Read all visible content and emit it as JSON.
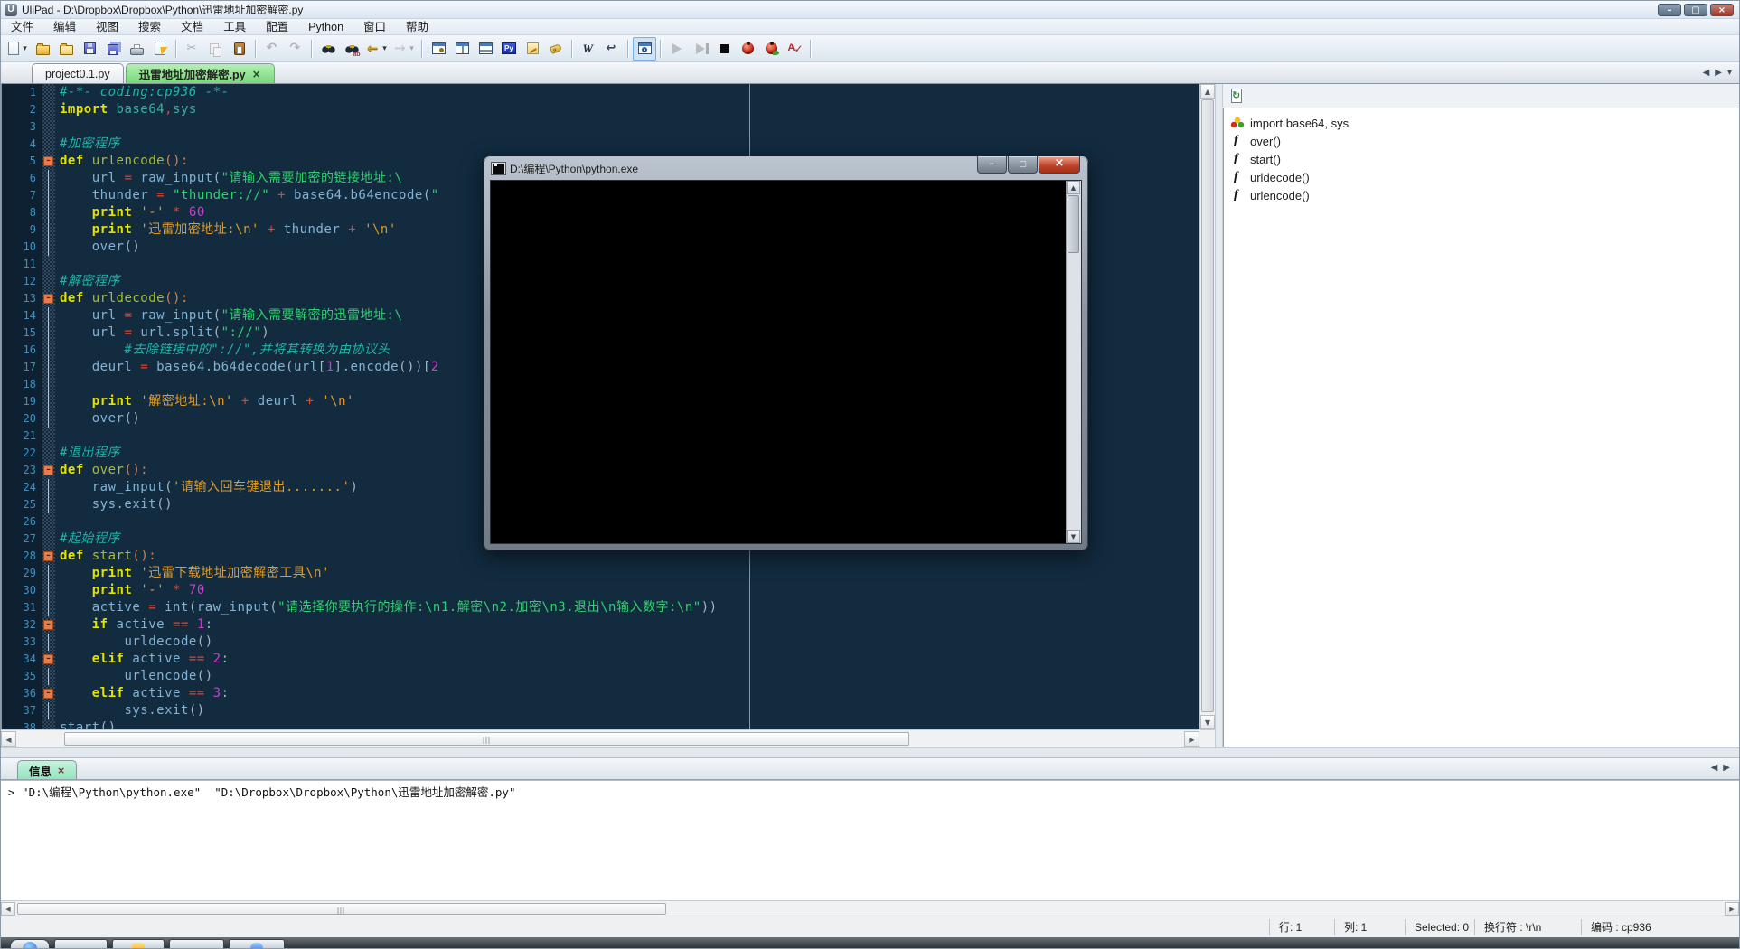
{
  "window": {
    "title": "UliPad - D:\\Dropbox\\Dropbox\\Python\\迅雷地址加密解密.py"
  },
  "menu": {
    "items": [
      {
        "id": "file",
        "label": "文件"
      },
      {
        "id": "edit",
        "label": "编辑"
      },
      {
        "id": "view",
        "label": "视图"
      },
      {
        "id": "search",
        "label": "搜索"
      },
      {
        "id": "document",
        "label": "文档"
      },
      {
        "id": "tools",
        "label": "工具"
      },
      {
        "id": "config",
        "label": "配置"
      },
      {
        "id": "python",
        "label": "Python"
      },
      {
        "id": "window",
        "label": "窗口"
      },
      {
        "id": "help",
        "label": "帮助"
      }
    ]
  },
  "toolbar": {
    "items": [
      {
        "id": "new-file",
        "icon": "page",
        "dd": true
      },
      {
        "id": "open-file",
        "icon": "folder-open"
      },
      {
        "id": "open-session",
        "icon": "folder"
      },
      {
        "id": "save",
        "icon": "floppy"
      },
      {
        "id": "save-all",
        "icon": "floppy-multi"
      },
      {
        "id": "print",
        "icon": "printer"
      },
      {
        "id": "shell-command",
        "icon": "page-flash"
      },
      {
        "sep": true
      },
      {
        "id": "cut",
        "icon": "cut",
        "disabled": true
      },
      {
        "id": "copy",
        "icon": "copy",
        "disabled": true
      },
      {
        "id": "paste",
        "icon": "paste"
      },
      {
        "sep": true
      },
      {
        "id": "undo",
        "icon": "undo",
        "disabled": true
      },
      {
        "id": "redo",
        "icon": "redo",
        "disabled": true
      },
      {
        "sep": true
      },
      {
        "id": "find",
        "icon": "find"
      },
      {
        "id": "replace",
        "icon": "replace"
      },
      {
        "id": "nav-back",
        "icon": "back",
        "dd": true
      },
      {
        "id": "nav-forward",
        "icon": "forward",
        "dd": true,
        "disabled": true
      },
      {
        "sep": true
      },
      {
        "id": "document-properties",
        "icon": "win-gear"
      },
      {
        "id": "split-vertically",
        "icon": "win-vsplit"
      },
      {
        "id": "split-horizontally",
        "icon": "win-hsplit"
      },
      {
        "id": "python-doc",
        "icon": "pyp"
      },
      {
        "id": "snippets",
        "icon": "note"
      },
      {
        "id": "bookmarks",
        "icon": "tag"
      },
      {
        "sep": true
      },
      {
        "id": "word-wrap",
        "icon": "wc"
      },
      {
        "id": "auto-indent",
        "icon": "indent"
      },
      {
        "sep": true
      },
      {
        "id": "messages-window",
        "icon": "preview",
        "pressed": true
      },
      {
        "sep": true
      },
      {
        "id": "run",
        "icon": "play",
        "disabled": true
      },
      {
        "id": "run-step",
        "icon": "play-step",
        "disabled": true
      },
      {
        "id": "stop",
        "icon": "stop"
      },
      {
        "id": "debug",
        "icon": "bug"
      },
      {
        "id": "debug-run",
        "icon": "bug-green"
      },
      {
        "id": "spell-check",
        "icon": "abc"
      },
      {
        "sep": true
      }
    ]
  },
  "tabs": [
    {
      "id": "project01",
      "label": "project0.1.py",
      "active": false
    },
    {
      "id": "thunder-codec",
      "label": "迅雷地址加密解密.py",
      "active": true,
      "close": "×"
    }
  ],
  "editor": {
    "lines": [
      {
        "n": 1,
        "f": "",
        "s": [
          [
            "#-*- coding:cp936 -*-",
            "cm"
          ]
        ]
      },
      {
        "n": 2,
        "f": "",
        "s": [
          [
            "import",
            "kw"
          ],
          [
            " ",
            ""
          ],
          [
            "base64",
            "md"
          ],
          [
            ",",
            "op"
          ],
          [
            "sys",
            "md"
          ]
        ]
      },
      {
        "n": 3,
        "f": "",
        "s": []
      },
      {
        "n": 4,
        "f": "",
        "s": [
          [
            "#加密程序",
            "cm"
          ]
        ]
      },
      {
        "n": 5,
        "f": "m",
        "s": [
          [
            "def",
            "kw"
          ],
          [
            " ",
            ""
          ],
          [
            "urlencode",
            "fn"
          ],
          [
            "():",
            "pd"
          ]
        ]
      },
      {
        "n": 6,
        "f": "l",
        "s": [
          [
            "    ",
            ""
          ],
          [
            "url",
            "id"
          ],
          [
            " = ",
            "op"
          ],
          [
            "raw_input",
            "id"
          ],
          [
            "(",
            "pn"
          ],
          [
            "\"请输入需要加密的链接地址:\\",
            "s2"
          ]
        ]
      },
      {
        "n": 7,
        "f": "l",
        "s": [
          [
            "    ",
            ""
          ],
          [
            "thunder",
            "id"
          ],
          [
            " = ",
            "op"
          ],
          [
            "\"thunder://\"",
            "s2"
          ],
          [
            " + ",
            "op"
          ],
          [
            "base64.b64encode",
            "id"
          ],
          [
            "(",
            "pn"
          ],
          [
            "\"",
            "s2"
          ]
        ]
      },
      {
        "n": 8,
        "f": "l",
        "s": [
          [
            "    ",
            ""
          ],
          [
            "print",
            "kw"
          ],
          [
            " ",
            ""
          ],
          [
            "'-'",
            "s1"
          ],
          [
            " ",
            ""
          ],
          [
            "*",
            "op"
          ],
          [
            " ",
            ""
          ],
          [
            "60",
            "nm"
          ]
        ]
      },
      {
        "n": 9,
        "f": "l",
        "s": [
          [
            "    ",
            ""
          ],
          [
            "print",
            "kw"
          ],
          [
            " ",
            ""
          ],
          [
            "'迅雷加密地址:\\n'",
            "s1"
          ],
          [
            " + ",
            "op"
          ],
          [
            "thunder",
            "id"
          ],
          [
            " + ",
            "op"
          ],
          [
            "'\\n'",
            "s1"
          ]
        ]
      },
      {
        "n": 10,
        "f": "l",
        "s": [
          [
            "    ",
            ""
          ],
          [
            "over",
            "id"
          ],
          [
            "()",
            "pn"
          ]
        ]
      },
      {
        "n": 11,
        "f": "",
        "s": []
      },
      {
        "n": 12,
        "f": "",
        "s": [
          [
            "#解密程序",
            "cm"
          ]
        ]
      },
      {
        "n": 13,
        "f": "m",
        "s": [
          [
            "def",
            "kw"
          ],
          [
            " ",
            ""
          ],
          [
            "urldecode",
            "fn"
          ],
          [
            "():",
            "pd"
          ]
        ]
      },
      {
        "n": 14,
        "f": "l",
        "s": [
          [
            "    ",
            ""
          ],
          [
            "url",
            "id"
          ],
          [
            " = ",
            "op"
          ],
          [
            "raw_input",
            "id"
          ],
          [
            "(",
            "pn"
          ],
          [
            "\"请输入需要解密的迅雷地址:\\",
            "s2"
          ]
        ]
      },
      {
        "n": 15,
        "f": "l",
        "s": [
          [
            "    ",
            ""
          ],
          [
            "url",
            "id"
          ],
          [
            " = ",
            "op"
          ],
          [
            "url.split",
            "id"
          ],
          [
            "(",
            "pn"
          ],
          [
            "\"://\"",
            "s2"
          ],
          [
            ")",
            "pn"
          ]
        ]
      },
      {
        "n": 16,
        "f": "l",
        "s": [
          [
            "        #去除链接中的\"://\",并将其转换为由协议头",
            "cm"
          ]
        ]
      },
      {
        "n": 17,
        "f": "l",
        "s": [
          [
            "    ",
            ""
          ],
          [
            "deurl",
            "id"
          ],
          [
            " = ",
            "op"
          ],
          [
            "base64.b64decode",
            "id"
          ],
          [
            "(",
            "pn"
          ],
          [
            "url",
            "id"
          ],
          [
            "[",
            "pn"
          ],
          [
            "1",
            "nm"
          ],
          [
            "]",
            "pn"
          ],
          [
            ".encode",
            "id"
          ],
          [
            "())[",
            "pn"
          ],
          [
            "2",
            "nm"
          ]
        ]
      },
      {
        "n": 18,
        "f": "l",
        "s": []
      },
      {
        "n": 19,
        "f": "l",
        "s": [
          [
            "    ",
            ""
          ],
          [
            "print",
            "kw"
          ],
          [
            " ",
            ""
          ],
          [
            "'解密地址:\\n'",
            "s1"
          ],
          [
            " + ",
            "op"
          ],
          [
            "deurl",
            "id"
          ],
          [
            " + ",
            "op"
          ],
          [
            "'\\n'",
            "s1"
          ]
        ]
      },
      {
        "n": 20,
        "f": "l",
        "s": [
          [
            "    ",
            ""
          ],
          [
            "over",
            "id"
          ],
          [
            "()",
            "pn"
          ]
        ]
      },
      {
        "n": 21,
        "f": "",
        "s": []
      },
      {
        "n": 22,
        "f": "",
        "s": [
          [
            "#退出程序",
            "cm"
          ]
        ]
      },
      {
        "n": 23,
        "f": "m",
        "s": [
          [
            "def",
            "kw"
          ],
          [
            " ",
            ""
          ],
          [
            "over",
            "fn"
          ],
          [
            "():",
            "pd"
          ]
        ]
      },
      {
        "n": 24,
        "f": "l",
        "s": [
          [
            "    ",
            ""
          ],
          [
            "raw_input",
            "id"
          ],
          [
            "(",
            "pn"
          ],
          [
            "'请输入回车键退出.......'",
            "s1"
          ],
          [
            ")",
            "pn"
          ]
        ]
      },
      {
        "n": 25,
        "f": "l",
        "s": [
          [
            "    ",
            ""
          ],
          [
            "sys.exit",
            "id"
          ],
          [
            "()",
            "pn"
          ]
        ]
      },
      {
        "n": 26,
        "f": "",
        "s": []
      },
      {
        "n": 27,
        "f": "",
        "s": [
          [
            "#起始程序",
            "cm"
          ]
        ]
      },
      {
        "n": 28,
        "f": "m",
        "s": [
          [
            "def",
            "kw"
          ],
          [
            " ",
            ""
          ],
          [
            "start",
            "fn"
          ],
          [
            "():",
            "pd"
          ]
        ]
      },
      {
        "n": 29,
        "f": "l",
        "s": [
          [
            "    ",
            ""
          ],
          [
            "print",
            "kw"
          ],
          [
            " ",
            ""
          ],
          [
            "'迅雷下载地址加密解密工具\\n'",
            "s1"
          ]
        ]
      },
      {
        "n": 30,
        "f": "l",
        "s": [
          [
            "    ",
            ""
          ],
          [
            "print",
            "kw"
          ],
          [
            " ",
            ""
          ],
          [
            "'-'",
            "s1"
          ],
          [
            " ",
            ""
          ],
          [
            "*",
            "op"
          ],
          [
            " ",
            ""
          ],
          [
            "70",
            "nm"
          ]
        ]
      },
      {
        "n": 31,
        "f": "l",
        "s": [
          [
            "    ",
            ""
          ],
          [
            "active",
            "id"
          ],
          [
            " = ",
            "op"
          ],
          [
            "int",
            "id"
          ],
          [
            "(",
            "pn"
          ],
          [
            "raw_input",
            "id"
          ],
          [
            "(",
            "pn"
          ],
          [
            "\"请选择你要执行的操作:\\n1.解密\\n2.加密\\n3.退出\\n输入数字:\\n\"",
            "s2"
          ],
          [
            "))",
            "pn"
          ]
        ]
      },
      {
        "n": 32,
        "f": "m",
        "s": [
          [
            "    ",
            ""
          ],
          [
            "if",
            "kw"
          ],
          [
            " ",
            ""
          ],
          [
            "active",
            "id"
          ],
          [
            " == ",
            "op"
          ],
          [
            "1",
            "nm"
          ],
          [
            ":",
            "pn"
          ]
        ]
      },
      {
        "n": 33,
        "f": "l",
        "s": [
          [
            "        ",
            ""
          ],
          [
            "urldecode",
            "id"
          ],
          [
            "()",
            "pn"
          ]
        ]
      },
      {
        "n": 34,
        "f": "m",
        "s": [
          [
            "    ",
            ""
          ],
          [
            "elif",
            "kw"
          ],
          [
            " ",
            ""
          ],
          [
            "active",
            "id"
          ],
          [
            " == ",
            "op"
          ],
          [
            "2",
            "nm"
          ],
          [
            ":",
            "pn"
          ]
        ]
      },
      {
        "n": 35,
        "f": "l",
        "s": [
          [
            "        ",
            ""
          ],
          [
            "urlencode",
            "id"
          ],
          [
            "()",
            "pn"
          ]
        ]
      },
      {
        "n": 36,
        "f": "m",
        "s": [
          [
            "    ",
            ""
          ],
          [
            "elif",
            "kw"
          ],
          [
            " ",
            ""
          ],
          [
            "active",
            "id"
          ],
          [
            " == ",
            "op"
          ],
          [
            "3",
            "nm"
          ],
          [
            ":",
            "pn"
          ]
        ]
      },
      {
        "n": 37,
        "f": "l",
        "s": [
          [
            "        ",
            ""
          ],
          [
            "sys.exit",
            "id"
          ],
          [
            "()",
            "pn"
          ]
        ]
      },
      {
        "n": 38,
        "f": "",
        "s": [
          [
            "start",
            "id"
          ],
          [
            "()",
            "pn"
          ]
        ]
      }
    ]
  },
  "console": {
    "title": "D:\\编程\\Python\\python.exe"
  },
  "outline": {
    "items": [
      {
        "icon": "import",
        "label": "import base64, sys"
      },
      {
        "icon": "func",
        "label": "over()"
      },
      {
        "icon": "func",
        "label": "start()"
      },
      {
        "icon": "func",
        "label": "urldecode()"
      },
      {
        "icon": "func",
        "label": "urlencode()"
      }
    ]
  },
  "message_panel": {
    "tab": "信息",
    "close": "×",
    "text": "> \"D:\\编程\\Python\\python.exe\"  \"D:\\Dropbox\\Dropbox\\Python\\迅雷地址加密解密.py\""
  },
  "status_bar": {
    "fields": [
      {
        "id": "line",
        "label": "行: 1"
      },
      {
        "id": "column",
        "label": "列: 1"
      },
      {
        "id": "selected",
        "label": "Selected: 0"
      },
      {
        "id": "eol",
        "label": "换行符 : \\r\\n"
      },
      {
        "id": "encoding",
        "label": "编码 : cp936"
      }
    ]
  },
  "taskbar": {
    "buttons": [
      {
        "id": "start-orb",
        "accent": "blue-orb"
      },
      {
        "id": "taskbar-app-1",
        "accent": "none"
      },
      {
        "id": "taskbar-app-2",
        "accent": "yellow"
      },
      {
        "id": "taskbar-app-3",
        "accent": "none"
      },
      {
        "id": "taskbar-app-4",
        "accent": "blue"
      }
    ]
  }
}
